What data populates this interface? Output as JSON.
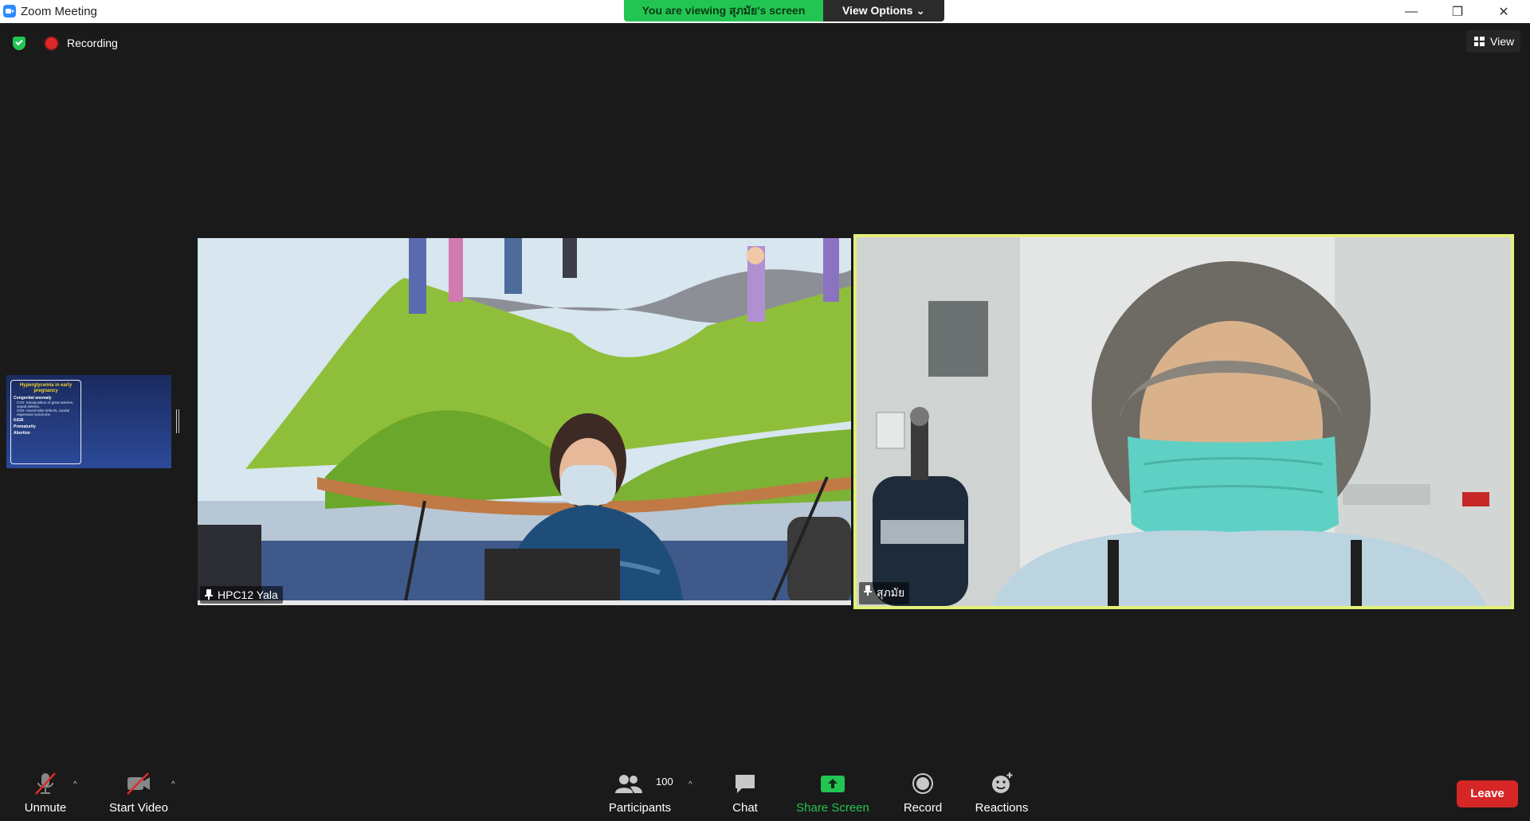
{
  "window": {
    "title": "Zoom Meeting",
    "viewing_banner": "You are viewing สุภมัย's screen",
    "view_options": "View Options ⌄",
    "controls": {
      "minimize": "—",
      "maximize": "❐",
      "close": "✕"
    }
  },
  "status": {
    "recording": "Recording",
    "view": "View"
  },
  "slide_thumbnail": {
    "title": "Hyperglycemia in early pregnancy",
    "lines": [
      "Congenital anomaly",
      "IUGR",
      "Prematurity",
      "Abortion"
    ],
    "sub_lines": [
      "CVS: transposition of great arteries, septal defects,",
      "CNS: neural tube defects, caudal regression syndrome"
    ]
  },
  "participants": [
    {
      "name": "HPC12 Yala",
      "active_speaker": false
    },
    {
      "name": "สุภมัย",
      "active_speaker": true
    }
  ],
  "toolbar": {
    "unmute": "Unmute",
    "start_video": "Start Video",
    "participants": "Participants",
    "participants_count": "100",
    "chat": "Chat",
    "share_screen": "Share Screen",
    "record": "Record",
    "reactions": "Reactions",
    "leave": "Leave"
  },
  "colors": {
    "accent_green": "#23c552",
    "leave_red": "#d62626",
    "active_speaker_border": "#e4f07a",
    "background": "#1a1a1a"
  }
}
